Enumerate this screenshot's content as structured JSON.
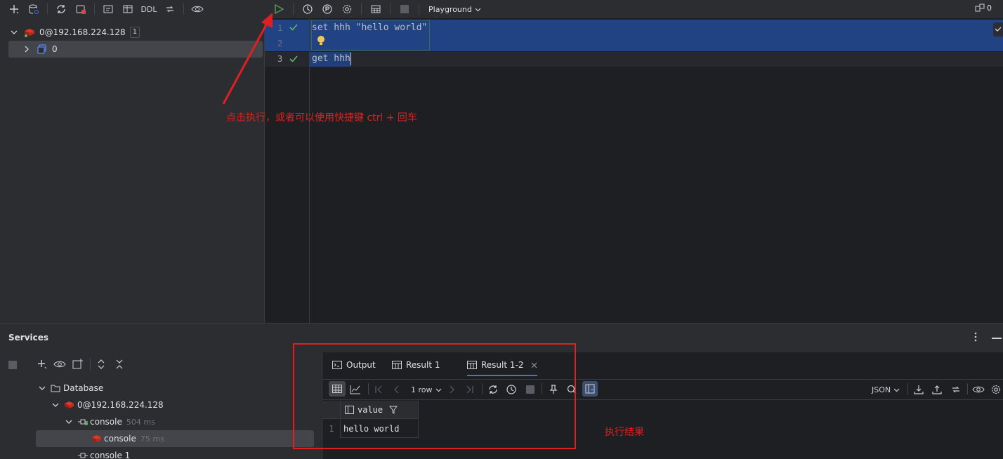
{
  "left_toolbar": {
    "ddl_label": "DDL"
  },
  "tree": {
    "root": {
      "label": "0@192.168.224.128",
      "badge": "1"
    },
    "child": {
      "label": "0"
    }
  },
  "editor_toolbar": {
    "playground_label": "Playground",
    "right_count": "0"
  },
  "editor": {
    "lines": [
      {
        "number": "1",
        "code": "set hhh \"hello world\""
      },
      {
        "number": "2",
        "code": ""
      },
      {
        "number": "3",
        "code": "get hhh"
      }
    ]
  },
  "annotations": {
    "run_hint": "点击执行，或者可以使用快捷键 ctrl + 回车",
    "result_hint": "执行结果"
  },
  "services": {
    "title": "Services",
    "tree": [
      {
        "label": "Database",
        "meta": ""
      },
      {
        "label": "0@192.168.224.128",
        "meta": ""
      },
      {
        "label": "console",
        "meta": "504 ms"
      },
      {
        "label": "console",
        "meta": "75 ms"
      },
      {
        "label": "console 1",
        "meta": ""
      }
    ],
    "tabs": [
      {
        "label": "Output"
      },
      {
        "label": "Result 1"
      },
      {
        "label": "Result 1-2"
      }
    ],
    "result_toolbar": {
      "rows_label": "1 row",
      "format_label": "JSON"
    },
    "grid": {
      "column": "value",
      "rows": [
        {
          "index": "1",
          "value": "hello world"
        }
      ]
    }
  },
  "colors": {
    "accent": "#3574f0",
    "run_green": "#57965c",
    "annotation_red": "#e02020",
    "selection": "#214283"
  }
}
